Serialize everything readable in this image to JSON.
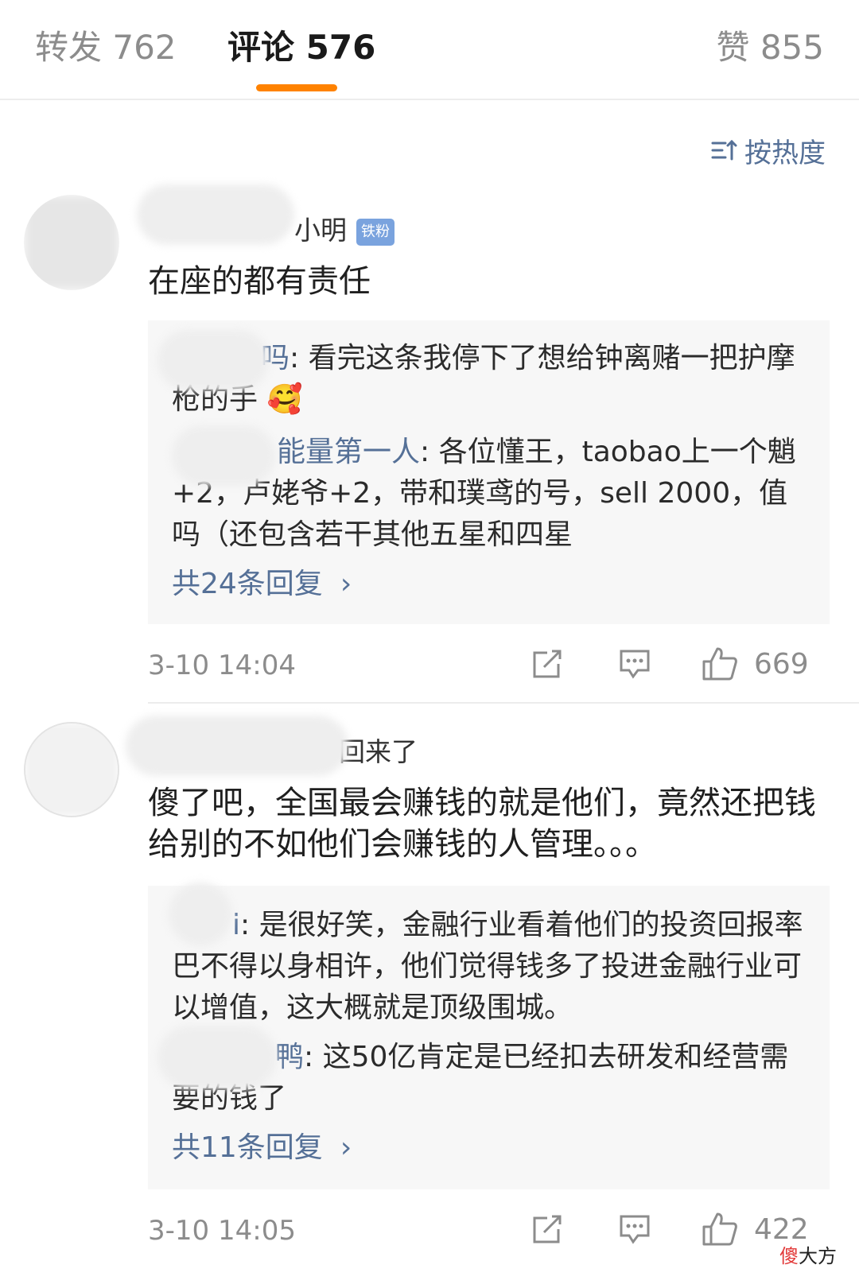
{
  "tabs": {
    "repost": "转发 762",
    "comment": "评论 576",
    "like": "赞 855"
  },
  "sort": {
    "label": "按热度",
    "icon": "sort-icon"
  },
  "comments": [
    {
      "name_visible": "小明",
      "badge": "铁粉",
      "text": "在座的都有责任",
      "replies": [
        {
          "name_visible": "吗",
          "text": ": 看完这条我停下了想给钟离赌一把护摩枪的手"
        },
        {
          "name_visible": "能量第一人",
          "text": ": 各位懂王，taobao上一个魈+2，卢姥爷+2，带和璞鸢的号，sell 2000，值吗（还包含若干其他五星和四星"
        }
      ],
      "more_replies": "共24条回复",
      "time": "3-10 14:04",
      "likes": "669"
    },
    {
      "name_visible": "回来了",
      "text": "傻了吧，全国最会赚钱的就是他们，竟然还把钱给别的不如他们会赚钱的人管理。。。",
      "replies": [
        {
          "name_visible": "i",
          "text": ": 是很好笑，金融行业看着他们的投资回报率巴不得以身相许，他们觉得钱多了投进金融行业可以增值，这大概就是顶级围城。"
        },
        {
          "name_visible": "鸭",
          "text": ": 这50亿肯定是已经扣去研发和经营需要的钱了"
        }
      ],
      "more_replies": "共11条回复",
      "time": "3-10 14:05",
      "likes": "422"
    }
  ],
  "watermark": {
    "red": "傻",
    "dark": "大方"
  },
  "colors": {
    "accent": "#ff8200",
    "link": "#557097",
    "badge": "#7aa3de",
    "muted": "#8c8c8c"
  }
}
